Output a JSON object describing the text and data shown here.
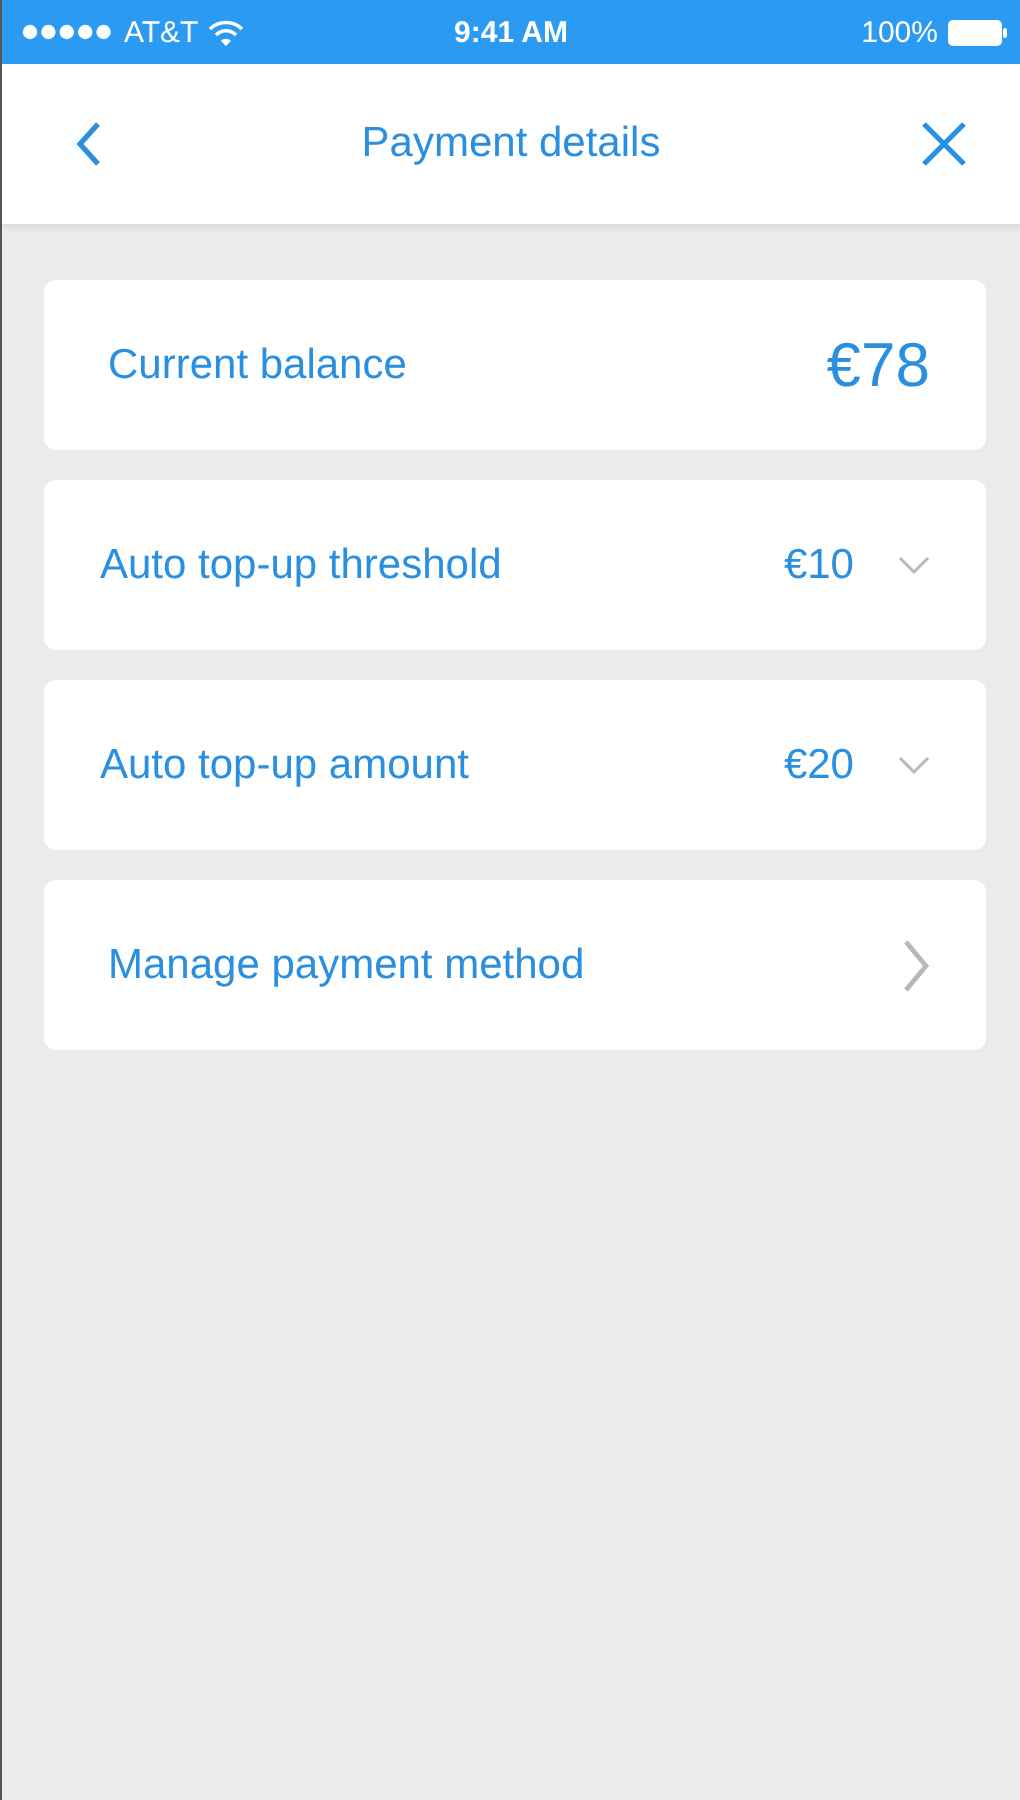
{
  "status_bar": {
    "carrier": "AT&T",
    "time": "9:41 AM",
    "battery": "100%"
  },
  "nav": {
    "title": "Payment details"
  },
  "rows": [
    {
      "kind": "balance",
      "label": "Current balance",
      "value": "€78"
    },
    {
      "kind": "dropdown",
      "label": "Auto top-up threshold",
      "value": "€10"
    },
    {
      "kind": "dropdown",
      "label": "Auto top-up amount",
      "value": "€20"
    },
    {
      "kind": "link",
      "label": "Manage payment method"
    }
  ]
}
